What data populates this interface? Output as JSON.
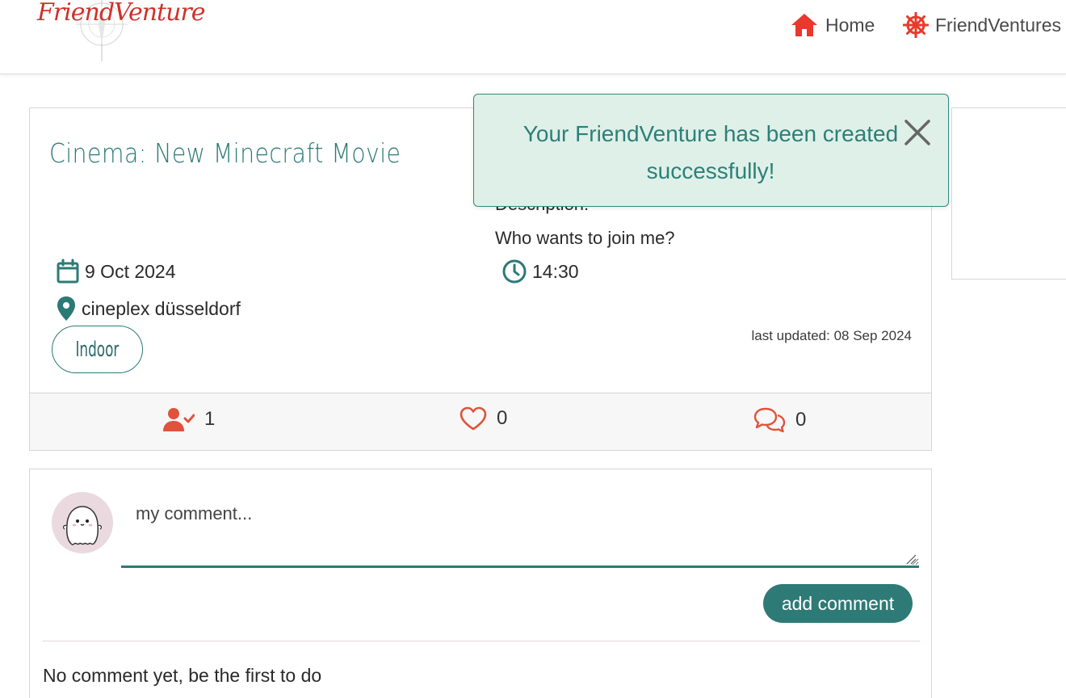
{
  "navbar": {
    "logo_text": "FriendVenture",
    "home_label": "Home",
    "friendventures_label": "FriendVentures"
  },
  "event": {
    "title": "Cinema: New Minecraft Movie",
    "description_label": "Description:",
    "description": "Who wants to join me?",
    "date": "9 Oct 2024",
    "time": "14:30",
    "location": "cineplex düsseldorf",
    "tag": "Indoor",
    "last_updated": "last updated: 08 Sep 2024",
    "participants_count": "1",
    "likes_count": "0",
    "comments_count": "0"
  },
  "comments": {
    "placeholder": "my comment...",
    "add_button_label": "add comment",
    "empty_text": "No comment yet, be the first to do"
  },
  "toast": {
    "message": "Your FriendVenture has been created successfully!"
  },
  "colors": {
    "accent": "#2c7a76",
    "brand_red": "#d0312a",
    "icon_orange": "#e0533a",
    "toast_bg": "#dff0e8"
  },
  "icons": {
    "home": "home-icon",
    "friendventures": "ship-wheel-icon",
    "date": "calendar-icon",
    "time": "clock-icon",
    "location": "map-pin-icon",
    "participants": "user-check-icon",
    "likes": "heart-icon",
    "comments": "comments-icon",
    "close": "close-icon"
  }
}
